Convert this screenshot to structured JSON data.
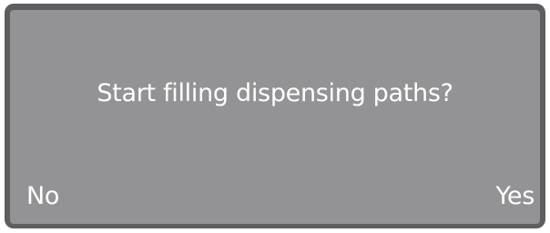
{
  "dialog": {
    "message": "Start filling dispensing paths?",
    "left_option": "No",
    "right_option": "Yes"
  },
  "colors": {
    "screen_background": "#939395",
    "bezel": "#5e5e60",
    "text": "#ffffff"
  }
}
